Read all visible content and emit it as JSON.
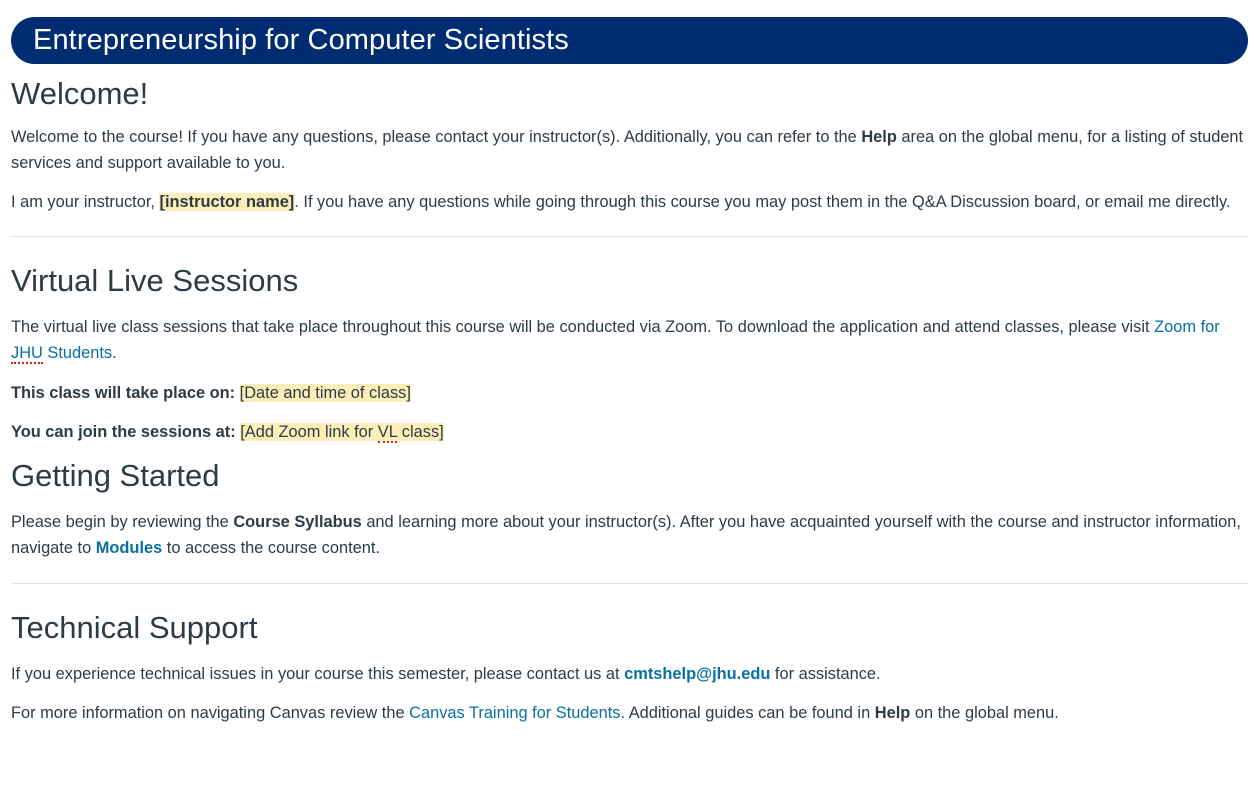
{
  "banner": {
    "title": "Entrepreneurship for Computer Scientists",
    "bg_color": "#002d72"
  },
  "welcome": {
    "heading": "Welcome!",
    "p1_before": "Welcome to the course! If you have any questions, please contact your instructor(s). Additionally, you can refer to the ",
    "p1_bold": "Help",
    "p1_after": " area on the global menu, for a listing of student services and support available to you.",
    "p2_before": "I am your instructor, ",
    "p2_highlight": "[instructor name]",
    "p2_after": ". If you have any questions while going through this course you may post them in the Q&A Discussion board, or email me directly."
  },
  "virtual": {
    "heading": "Virtual Live Sessions",
    "p1_before": "The virtual live class sessions that take place throughout this course will be conducted via Zoom. To download the application and attend classes, please visit ",
    "zoom_link_pre": "Zoom for ",
    "zoom_link_abbr": "JHU",
    "zoom_link_post": " Students",
    "p1_after": ".",
    "class_time_label": "This class will take place on:",
    "class_time_value": "[Date and time of class]",
    "join_label": "You can join the sessions at:",
    "join_value_pre": "[Add Zoom link for ",
    "join_value_abbr": "VL",
    "join_value_post": " class]"
  },
  "getting_started": {
    "heading": "Getting Started",
    "p1_before": "Please begin by reviewing the ",
    "p1_bold": "Course Syllabus",
    "p1_middle": " and learning more about your instructor(s). After you have acquainted yourself with the course and instructor information, navigate to ",
    "modules_link": "Modules",
    "p1_after": " to access the course content."
  },
  "tech_support": {
    "heading": "Technical Support",
    "p1_before": "If you experience technical issues in your course this semester, please contact us at ",
    "email_link": "cmtshelp@jhu.edu",
    "p1_after": " for assistance.",
    "p2_before": "For more information on navigating Canvas review the ",
    "canvas_link": "Canvas Training for Students",
    "p2_middle": ". Additional guides can be found in ",
    "p2_bold": "Help",
    "p2_after": " on the global menu."
  },
  "colors": {
    "link": "#0770a3",
    "highlight": "#fbeeb8",
    "text": "#2d3b45",
    "separator": "#e1e4e6"
  }
}
